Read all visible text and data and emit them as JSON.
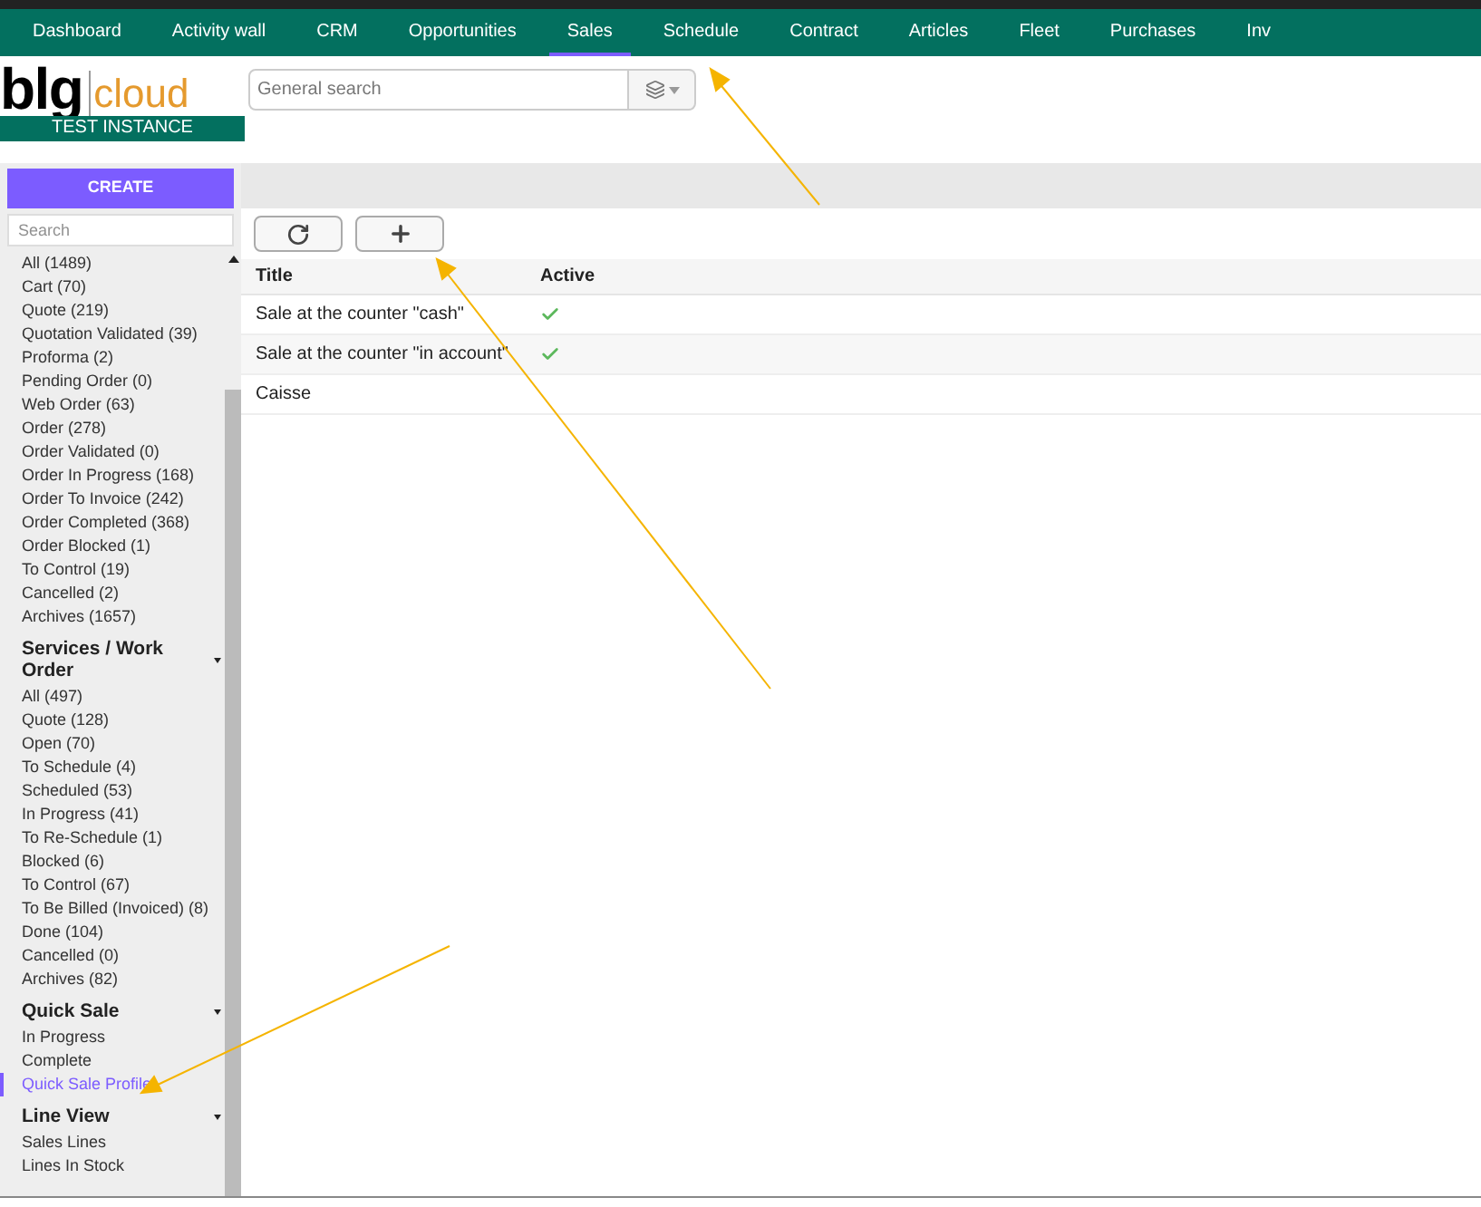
{
  "nav": [
    {
      "label": "Dashboard",
      "selected": false
    },
    {
      "label": "Activity wall",
      "selected": false
    },
    {
      "label": "CRM",
      "selected": false
    },
    {
      "label": "Opportunities",
      "selected": false
    },
    {
      "label": "Sales",
      "selected": true
    },
    {
      "label": "Schedule",
      "selected": false
    },
    {
      "label": "Contract",
      "selected": false
    },
    {
      "label": "Articles",
      "selected": false
    },
    {
      "label": "Fleet",
      "selected": false
    },
    {
      "label": "Purchases",
      "selected": false
    },
    {
      "label": "Inv",
      "selected": false
    }
  ],
  "logo": {
    "word_1": "blg",
    "word_2": "cloud",
    "banner": "TEST INSTANCE"
  },
  "search": {
    "placeholder": "General search"
  },
  "sidebar": {
    "create_button": "CREATE",
    "search_placeholder": "Search",
    "groups": [
      {
        "items": [
          {
            "label": "All (1489)",
            "selected": false
          },
          {
            "label": "Cart (70)",
            "selected": false
          },
          {
            "label": "Quote (219)",
            "selected": false
          },
          {
            "label": "Quotation Validated (39)",
            "selected": false
          },
          {
            "label": "Proforma (2)",
            "selected": false
          },
          {
            "label": "Pending Order (0)",
            "selected": false
          },
          {
            "label": "Web Order (63)",
            "selected": false
          },
          {
            "label": "Order (278)",
            "selected": false
          },
          {
            "label": "Order Validated (0)",
            "selected": false
          },
          {
            "label": "Order In Progress (168)",
            "selected": false
          },
          {
            "label": "Order To Invoice (242)",
            "selected": false
          },
          {
            "label": "Order Completed (368)",
            "selected": false
          },
          {
            "label": "Order Blocked (1)",
            "selected": false
          },
          {
            "label": "To Control (19)",
            "selected": false
          },
          {
            "label": "Cancelled (2)",
            "selected": false
          },
          {
            "label": "Archives (1657)",
            "selected": false
          }
        ]
      },
      {
        "title": "Services / Work Order",
        "items": [
          {
            "label": "All (497)",
            "selected": false
          },
          {
            "label": "Quote (128)",
            "selected": false
          },
          {
            "label": "Open (70)",
            "selected": false
          },
          {
            "label": "To Schedule (4)",
            "selected": false
          },
          {
            "label": "Scheduled (53)",
            "selected": false
          },
          {
            "label": "In Progress (41)",
            "selected": false
          },
          {
            "label": "To Re-Schedule (1)",
            "selected": false
          },
          {
            "label": "Blocked (6)",
            "selected": false
          },
          {
            "label": "To Control (67)",
            "selected": false
          },
          {
            "label": "To Be Billed (Invoiced) (8)",
            "selected": false
          },
          {
            "label": "Done (104)",
            "selected": false
          },
          {
            "label": "Cancelled (0)",
            "selected": false
          },
          {
            "label": "Archives (82)",
            "selected": false
          }
        ]
      },
      {
        "title": "Quick Sale",
        "items": [
          {
            "label": "In Progress",
            "selected": false
          },
          {
            "label": "Complete",
            "selected": false
          },
          {
            "label": "Quick Sale Profile",
            "selected": true
          }
        ]
      },
      {
        "title": "Line View",
        "items": [
          {
            "label": "Sales Lines",
            "selected": false
          },
          {
            "label": "Lines In Stock",
            "selected": false
          }
        ]
      }
    ]
  },
  "table": {
    "columns": [
      "Title",
      "Active"
    ],
    "rows": [
      {
        "title": "Sale at the counter \"cash\"",
        "active": true
      },
      {
        "title": "Sale at the counter \"in account\"",
        "active": true
      },
      {
        "title": "Caisse",
        "active": false
      }
    ]
  }
}
